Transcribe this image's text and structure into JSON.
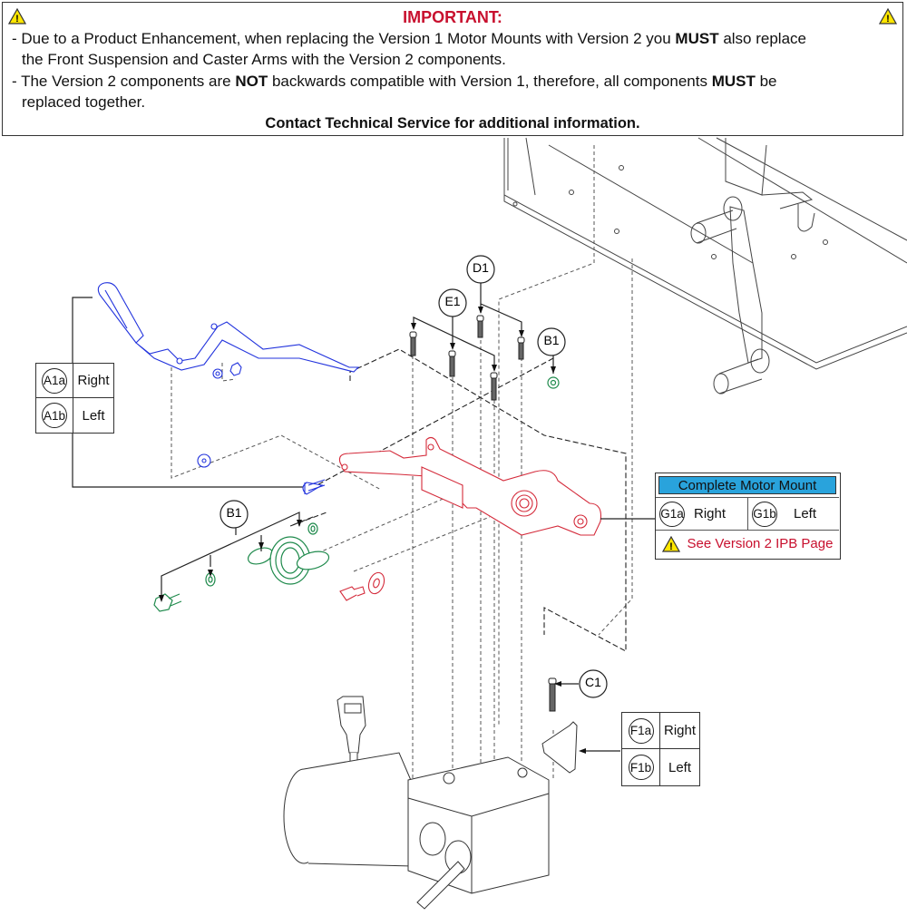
{
  "notice": {
    "title": "IMPORTANT:",
    "warning_icon": "warning-triangle-icon",
    "line1_pre": "- Due to a Product Enhancement, when replacing the Version 1 Motor Mounts with Version 2 you ",
    "line1_bold": "MUST",
    "line1_post": " also replace",
    "line2": "the Front Suspension and Caster Arms with the Version 2 components.",
    "line3_pre": "- The Version 2 components are ",
    "line3_bold1": "NOT",
    "line3_mid": " backwards compatible with Version 1, therefore, all components ",
    "line3_bold2": "MUST",
    "line3_post": " be",
    "line4": "replaced together.",
    "contact": "Contact Technical Service for additional information."
  },
  "callouts": {
    "d1": "D1",
    "e1": "E1",
    "b1_top": "B1",
    "b1_left": "B1",
    "c1": "C1"
  },
  "table_a": {
    "rows": [
      {
        "code": "A1a",
        "side": "Right"
      },
      {
        "code": "A1b",
        "side": "Left"
      }
    ]
  },
  "table_g": {
    "header": "Complete Motor Mount",
    "header_color": "#29a3dc",
    "items": [
      {
        "code": "G1a",
        "side": "Right"
      },
      {
        "code": "G1b",
        "side": "Left"
      }
    ],
    "note": "See Version 2 IPB Page",
    "note_color": "#c8102e"
  },
  "table_f": {
    "rows": [
      {
        "code": "F1a",
        "side": "Right"
      },
      {
        "code": "F1b",
        "side": "Left"
      }
    ]
  },
  "colors": {
    "caster_arm": "#2233dd",
    "motor_mount": "#d42a3a",
    "hardware": "#1f8a4c"
  }
}
